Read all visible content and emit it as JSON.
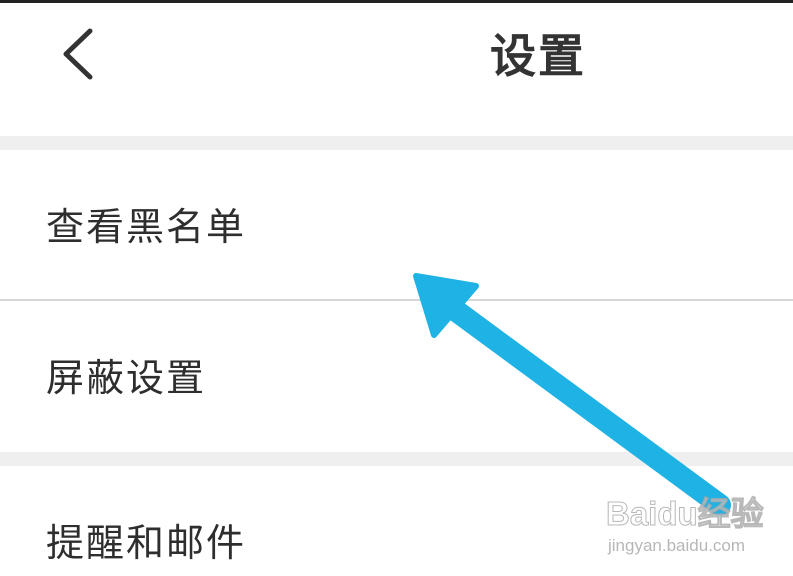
{
  "header": {
    "title": "设置",
    "back_icon": "chevron-left-icon"
  },
  "settings_list": {
    "items": [
      {
        "label": "查看黑名单"
      },
      {
        "label": "屏蔽设置"
      },
      {
        "label": "提醒和邮件"
      }
    ]
  },
  "annotation": {
    "type": "arrow",
    "color": "#1fb2e4",
    "points_to": "查看黑名单"
  },
  "watermark": {
    "brand": "Baidu经验",
    "url": "jingyan.baidu.com"
  },
  "colors": {
    "background": "#ffffff",
    "separator_gap": "#efefef",
    "divider": "#d8d8d8",
    "text": "#2e2e2e"
  }
}
